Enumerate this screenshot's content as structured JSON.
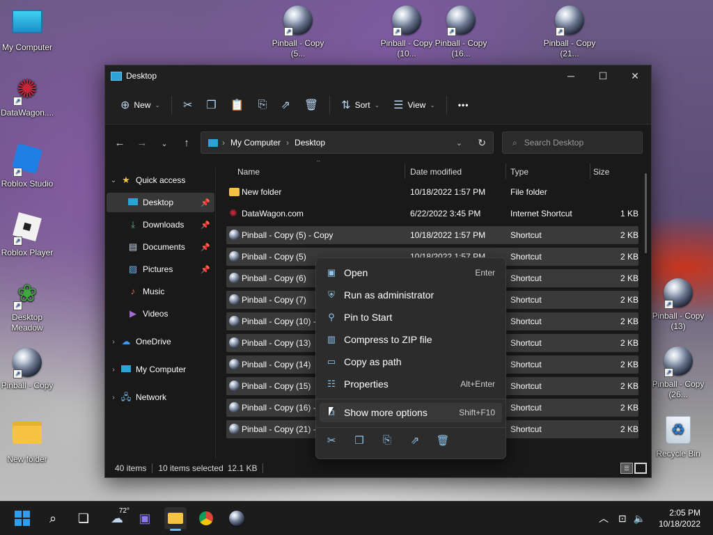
{
  "desktop": {
    "icons_left": [
      {
        "label": "My Computer",
        "icon": "computer-icon"
      },
      {
        "label": "DataWagon....",
        "icon": "datawagon-icon"
      },
      {
        "label": "Roblox Studio",
        "icon": "roblox-studio-icon"
      },
      {
        "label": "Roblox Player",
        "icon": "roblox-player-icon"
      },
      {
        "label": "Desktop Meadow",
        "icon": "meadow-icon"
      },
      {
        "label": "Pinball - Copy",
        "icon": "pinball-icon"
      },
      {
        "label": "New folder",
        "icon": "folder-icon"
      }
    ],
    "icons_top": [
      {
        "label": "Pinball - Copy (5..."
      },
      {
        "label": "Pinball - Copy (10..."
      },
      {
        "label": "Pinball - Copy (16..."
      },
      {
        "label": "Pinball - Copy (21..."
      }
    ],
    "icons_right": [
      {
        "label": "Pinball - Copy (13)"
      },
      {
        "label": "Pinball - Copy (26..."
      },
      {
        "label": "Recycle Bin"
      }
    ]
  },
  "window": {
    "title": "Desktop",
    "controls": {
      "minimize": "─",
      "maximize": "☐",
      "close": "✕"
    },
    "toolbar": {
      "new_label": "New",
      "sort_label": "Sort",
      "view_label": "View",
      "more": "•••"
    },
    "address": {
      "root": "My Computer",
      "folder": "Desktop",
      "separator": "›"
    },
    "search": {
      "placeholder": "Search Desktop"
    },
    "nav": {
      "quick_access": "Quick access",
      "items": [
        {
          "label": "Desktop",
          "icon": "desktop-icon",
          "pinned": true
        },
        {
          "label": "Downloads",
          "icon": "download-icon",
          "pinned": true
        },
        {
          "label": "Documents",
          "icon": "document-icon",
          "pinned": true
        },
        {
          "label": "Pictures",
          "icon": "picture-icon",
          "pinned": true
        },
        {
          "label": "Music",
          "icon": "music-icon",
          "pinned": false
        },
        {
          "label": "Videos",
          "icon": "video-icon",
          "pinned": false
        }
      ],
      "onedrive": "OneDrive",
      "my_computer": "My Computer",
      "network": "Network"
    },
    "columns": {
      "name": "Name",
      "date": "Date modified",
      "type": "Type",
      "size": "Size"
    },
    "files": [
      {
        "name": "New folder",
        "date": "10/18/2022 1:57 PM",
        "type": "File folder",
        "size": "",
        "kind": "folder",
        "selected": false
      },
      {
        "name": "DataWagon.com",
        "date": "6/22/2022 3:45 PM",
        "type": "Internet Shortcut",
        "size": "1 KB",
        "kind": "web",
        "selected": false
      },
      {
        "name": "Pinball - Copy (5) - Copy",
        "date": "10/18/2022 1:57 PM",
        "type": "Shortcut",
        "size": "2 KB",
        "kind": "pinball",
        "selected": true
      },
      {
        "name": "Pinball - Copy (5)",
        "date": "10/18/2022 1:57 PM",
        "type": "Shortcut",
        "size": "2 KB",
        "kind": "pinball",
        "selected": true
      },
      {
        "name": "Pinball - Copy (6)",
        "date": "",
        "type": "Shortcut",
        "size": "2 KB",
        "kind": "pinball",
        "selected": true
      },
      {
        "name": "Pinball - Copy (7)",
        "date": "",
        "type": "Shortcut",
        "size": "2 KB",
        "kind": "pinball",
        "selected": true
      },
      {
        "name": "Pinball - Copy (10) -",
        "date": "",
        "type": "Shortcut",
        "size": "2 KB",
        "kind": "pinball",
        "selected": true
      },
      {
        "name": "Pinball - Copy (13)",
        "date": "",
        "type": "Shortcut",
        "size": "2 KB",
        "kind": "pinball",
        "selected": true
      },
      {
        "name": "Pinball - Copy (14)",
        "date": "",
        "type": "Shortcut",
        "size": "2 KB",
        "kind": "pinball",
        "selected": true
      },
      {
        "name": "Pinball - Copy (15)",
        "date": "",
        "type": "Shortcut",
        "size": "2 KB",
        "kind": "pinball",
        "selected": true
      },
      {
        "name": "Pinball - Copy (16) -",
        "date": "",
        "type": "Shortcut",
        "size": "2 KB",
        "kind": "pinball",
        "selected": true
      },
      {
        "name": "Pinball - Copy (21) -",
        "date": "",
        "type": "Shortcut",
        "size": "2 KB",
        "kind": "pinball",
        "selected": true
      }
    ],
    "status": {
      "items": "40 items",
      "selected": "10 items selected",
      "size": "12.1 KB"
    }
  },
  "context_menu": {
    "items": [
      {
        "label": "Open",
        "accel": "Enter",
        "icon": "open-icon"
      },
      {
        "label": "Run as administrator",
        "accel": "",
        "icon": "shield-icon"
      },
      {
        "label": "Pin to Start",
        "accel": "",
        "icon": "pin-icon"
      },
      {
        "label": "Compress to ZIP file",
        "accel": "",
        "icon": "zip-icon"
      },
      {
        "label": "Copy as path",
        "accel": "",
        "icon": "path-icon"
      },
      {
        "label": "Properties",
        "accel": "Alt+Enter",
        "icon": "properties-icon"
      }
    ],
    "more": {
      "label": "Show more options",
      "accel": "Shift+F10"
    }
  },
  "taskbar": {
    "weather": "72°",
    "time": "2:05 PM",
    "date": "10/18/2022"
  },
  "colors": {
    "accent": "#2f9ef0",
    "window_bg": "#191919",
    "selection": "#3a3a3a"
  }
}
